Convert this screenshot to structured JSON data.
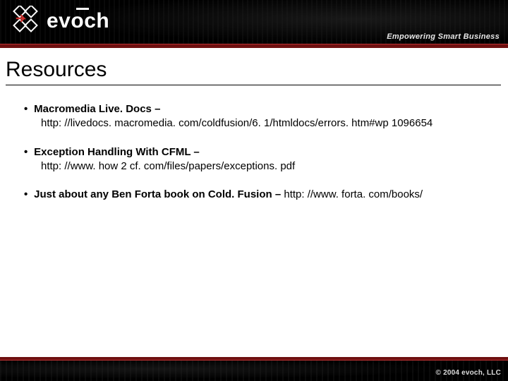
{
  "header": {
    "brand": "evoch",
    "tagline": "Empowering Smart Business"
  },
  "title": "Resources",
  "items": [
    {
      "label": "Macromedia Live. Docs –",
      "link": "http: //livedocs. macromedia. com/coldfusion/6. 1/htmldocs/errors. htm#wp 1096654",
      "inline": false
    },
    {
      "label": "Exception Handling With CFML –",
      "link": "http: //www. how 2 cf. com/files/papers/exceptions. pdf",
      "inline": false
    },
    {
      "label": "Just about any Ben Forta book on Cold. Fusion –",
      "link": "http: //www. forta. com/books/",
      "inline": true
    }
  ],
  "footer": {
    "copyright": "© 2004 evoch, LLC"
  }
}
